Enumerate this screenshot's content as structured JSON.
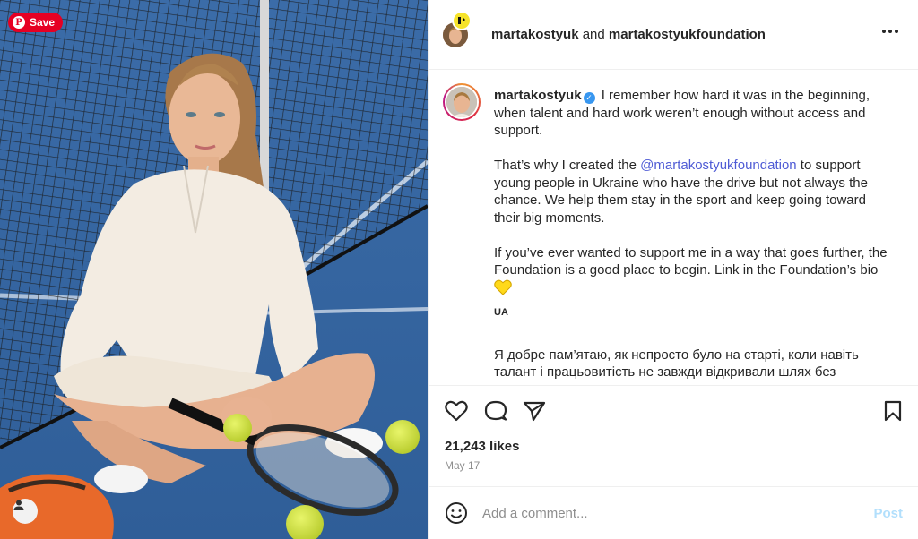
{
  "pin": {
    "save_label": "Save",
    "pin_glyph": "P"
  },
  "header": {
    "author": "martakostyuk",
    "joiner": " and ",
    "coauthor": "martakostyukfoundation"
  },
  "caption": {
    "username": "martakostyuk",
    "para1": "I remember how hard it was in the beginning, when talent and hard work weren’t enough without access and support.",
    "para2_before": "That’s why I created the ",
    "para2_mention": "@martakostyukfoundation",
    "para2_after": " to support young people in Ukraine who have the drive but not always the chance. We help them stay in the sport and keep going toward their big moments.",
    "para3": "If you’ve ever wanted to support me in a way that goes further, the Foundation is a good place to begin. Link in the Foundation’s bio",
    "lang_tag": "UA",
    "para4": "Я добре пам’ятаю, як непросто було на старті, коли навіть талант і працьовитість не завжди відкривали шлях без доступу та"
  },
  "stats": {
    "likes": "21,243 likes",
    "date": "May 17"
  },
  "comment": {
    "placeholder": "Add a comment...",
    "post_label": "Post"
  },
  "colors": {
    "pinterest_red": "#e60023",
    "verified_blue": "#3897f0",
    "mention": "#4f5bd5",
    "post_disabled": "#b2dffc",
    "foundation_yellow": "#f6e32a"
  },
  "icons": [
    "pinterest-icon",
    "user-icon",
    "more-icon",
    "verified-icon",
    "yellow-heart-icon",
    "heart-icon",
    "comment-icon",
    "share-icon",
    "bookmark-icon",
    "emoji-icon"
  ]
}
